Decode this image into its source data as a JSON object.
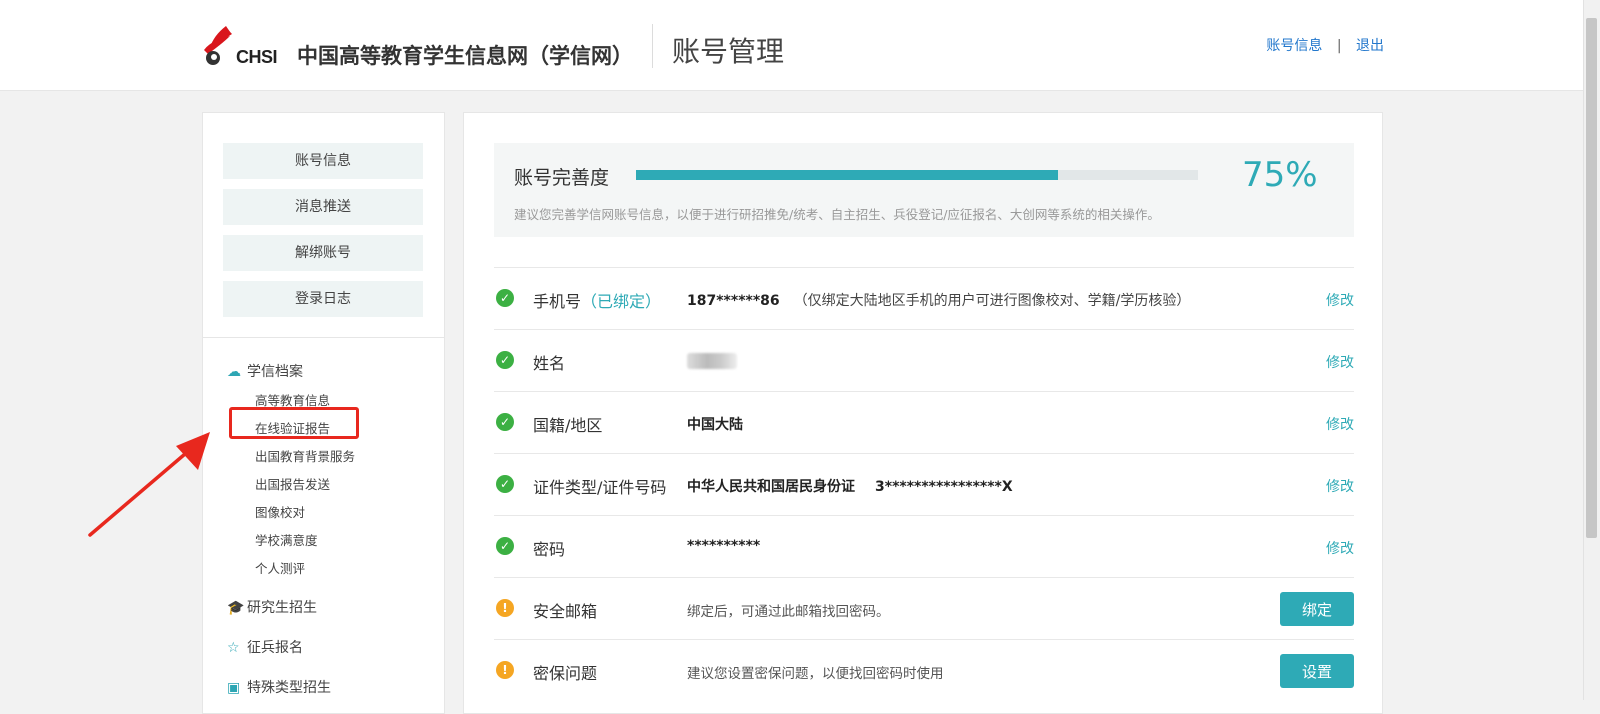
{
  "header": {
    "logo_text": "CHSI",
    "site_name": "中国高等教育学生信息网（学信网）",
    "page_title": "账号管理",
    "links": [
      "账号信息",
      "退出"
    ],
    "separator": "|"
  },
  "sidebar": {
    "buttons": [
      "账号信息",
      "消息推送",
      "解绑账号",
      "登录日志"
    ],
    "group_archive": {
      "title": "学信档案",
      "items": [
        "高等教育信息",
        "在线验证报告",
        "出国教育背景服务",
        "出国报告发送",
        "图像校对",
        "学校满意度",
        "个人测评"
      ]
    },
    "groups": [
      "研究生招生",
      "征兵报名",
      "特殊类型招生"
    ]
  },
  "completeness": {
    "label": "账号完善度",
    "percent_text": "75%",
    "percent": 75,
    "hint": "建议您完善学信网账号信息，以便于进行研招推免/统考、自主招生、兵役登记/应征报名、大创网等系统的相关操作。"
  },
  "rows": {
    "phone": {
      "label": "手机号",
      "bound": "（已绑定）",
      "value": "187******86",
      "note": "（仅绑定大陆地区手机的用户可进行图像校对、学籍/学历核验）",
      "action": "修改"
    },
    "name": {
      "label": "姓名",
      "action": "修改"
    },
    "nationality": {
      "label": "国籍/地区",
      "value": "中国大陆",
      "action": "修改"
    },
    "id": {
      "label": "证件类型/证件号码",
      "type": "中华人民共和国居民身份证",
      "value": "3****************X",
      "action": "修改"
    },
    "password": {
      "label": "密码",
      "value": "**********",
      "action": "修改"
    },
    "email": {
      "label": "安全邮箱",
      "value": "绑定后，可通过此邮箱找回密码。",
      "action": "绑定"
    },
    "question": {
      "label": "密保问题",
      "value": "建议您设置密保问题，以便找回密码时使用",
      "action": "设置"
    }
  },
  "colors": {
    "accent": "#2eaab6",
    "ok": "#3cb043",
    "warn": "#f5a623",
    "highlight": "#e8281e",
    "link": "#2277cc"
  }
}
